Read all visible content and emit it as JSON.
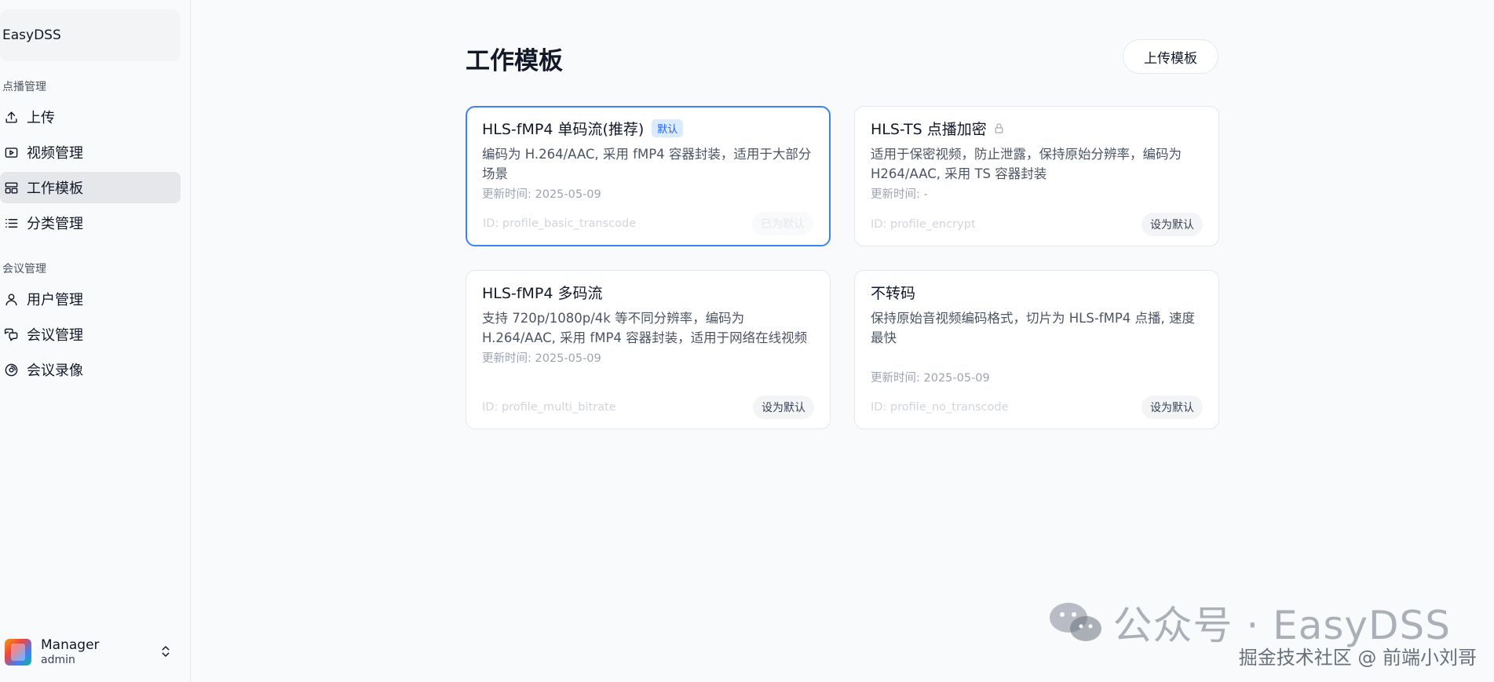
{
  "sidebar": {
    "brand": "EasyDSS",
    "groups": [
      {
        "label": "点播管理",
        "items": [
          {
            "label": "上传",
            "icon": "upload-icon"
          },
          {
            "label": "视频管理",
            "icon": "video-icon"
          },
          {
            "label": "工作模板",
            "icon": "template-icon",
            "active": true
          },
          {
            "label": "分类管理",
            "icon": "list-icon"
          }
        ]
      },
      {
        "label": "会议管理",
        "items": [
          {
            "label": "用户管理",
            "icon": "user-icon"
          },
          {
            "label": "会议管理",
            "icon": "chat-icon"
          },
          {
            "label": "会议录像",
            "icon": "record-icon"
          }
        ]
      }
    ],
    "user": {
      "name": "Manager",
      "role": "admin"
    }
  },
  "main": {
    "title": "工作模板",
    "upload_label": "上传模板",
    "cards": [
      {
        "title": "HLS-fMP4 单码流(推荐)",
        "badge": "默认",
        "desc": "编码为 H.264/AAC, 采用 fMP4 容器封装，适用于大部分场景",
        "time": "更新时间: 2025-05-09",
        "id": "ID: profile_basic_transcode",
        "button": "已为默认"
      },
      {
        "title": "HLS-TS 点播加密",
        "desc": "适用于保密视频，防止泄露，保持原始分辨率，编码为 H264/AAC, 采用 TS 容器封装",
        "time": "更新时间: -",
        "id": "ID: profile_encrypt",
        "button": "设为默认"
      },
      {
        "title": "HLS-fMP4 多码流",
        "desc": "支持 720p/1080p/4k 等不同分辨率，编码为 H.264/AAC, 采用 fMP4 容器封装，适用于网络在线视频",
        "time": "更新时间: 2025-05-09",
        "id": "ID: profile_multi_bitrate",
        "button": "设为默认"
      },
      {
        "title": "不转码",
        "desc": "保持原始音视频编码格式，切片为 HLS-fMP4 点播, 速度最快",
        "time": "更新时间: 2025-05-09",
        "id": "ID: profile_no_transcode",
        "button": "设为默认"
      }
    ]
  },
  "watermark": {
    "main": "公众号 · EasyDSS",
    "sub": "掘金技术社区 @ 前端小刘哥"
  }
}
